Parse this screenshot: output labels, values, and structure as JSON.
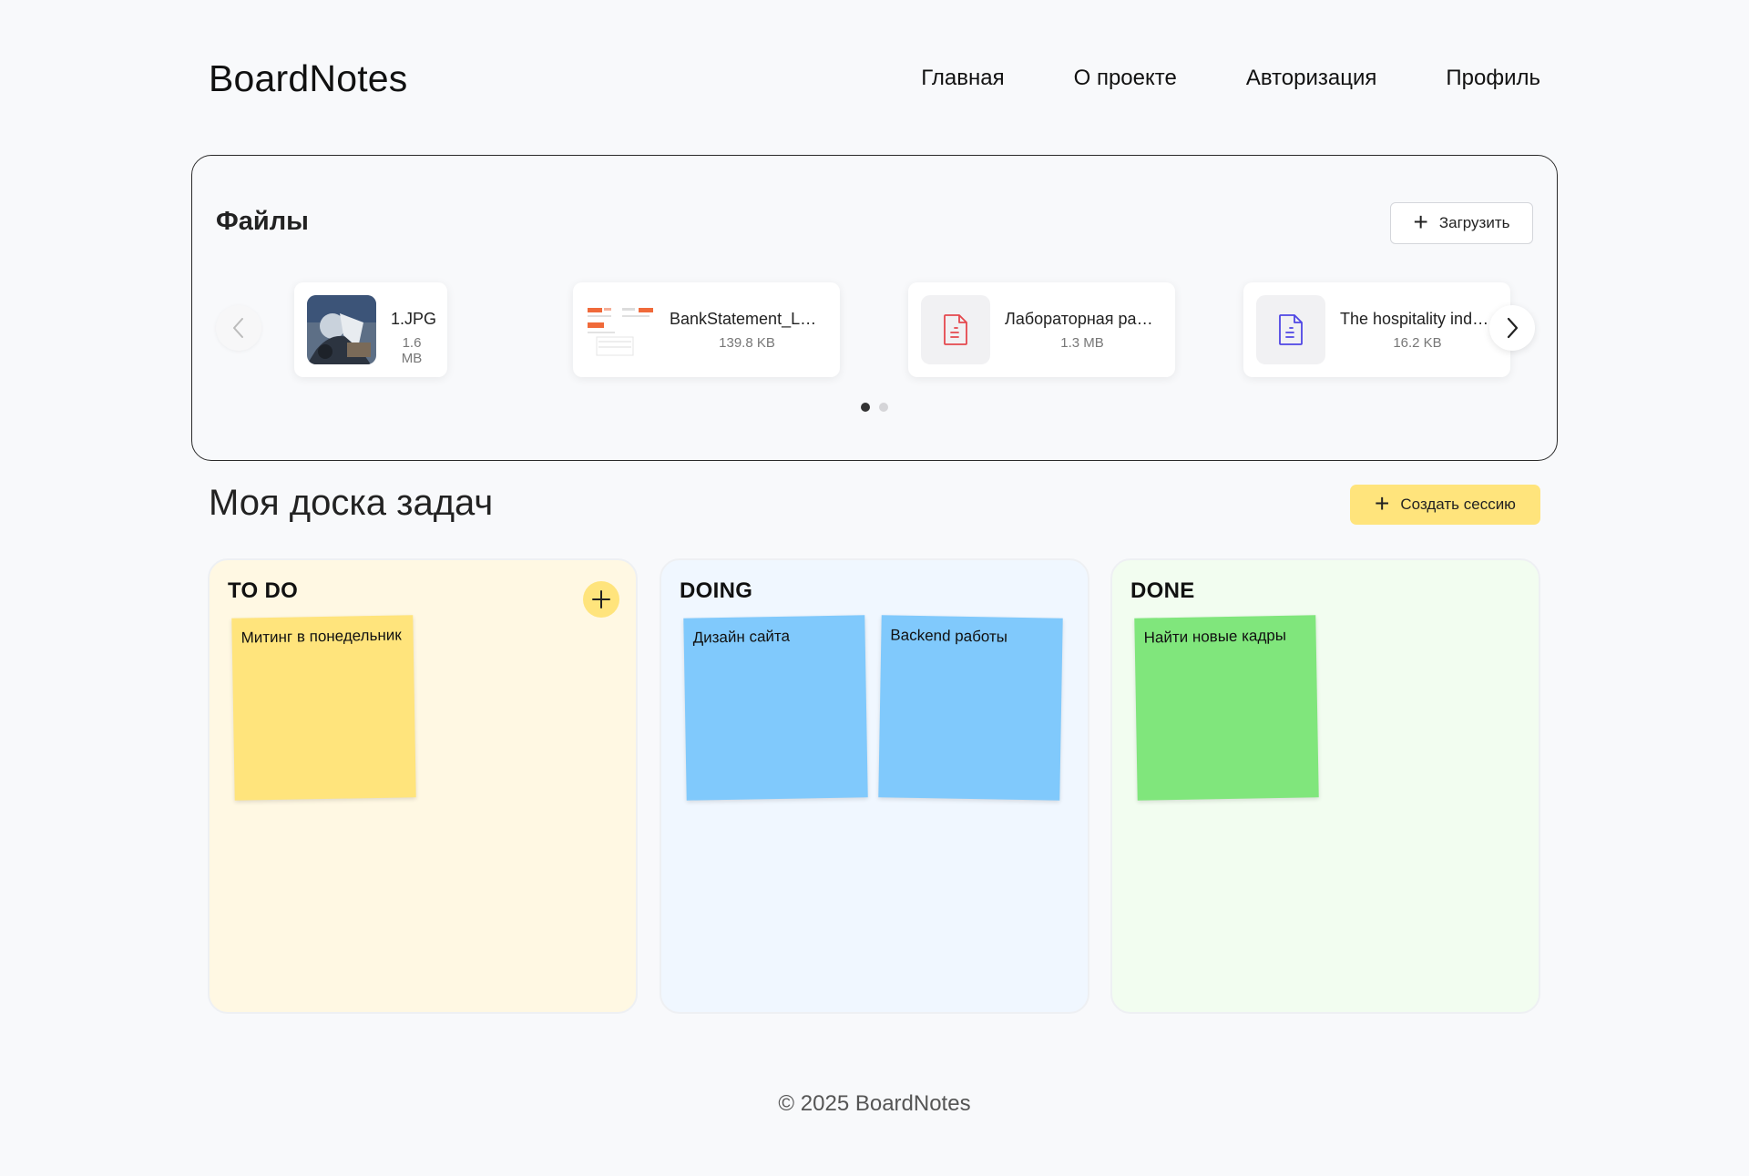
{
  "header": {
    "logo": "BoardNotes",
    "nav": [
      "Главная",
      "О проекте",
      "Авторизация",
      "Профиль"
    ]
  },
  "files": {
    "title": "Файлы",
    "upload_label": "Загрузить",
    "items": [
      {
        "name": "1.JPG",
        "size": "1.6 MB",
        "kind": "image"
      },
      {
        "name": "BankStatement_La…",
        "size": "139.8 KB",
        "kind": "statement"
      },
      {
        "name": "Лабораторная раб…",
        "size": "1.3 MB",
        "kind": "pdf"
      },
      {
        "name": "The hospitality indu…",
        "size": "16.2 KB",
        "kind": "doc"
      }
    ],
    "pagination": {
      "current": 1,
      "total": 2
    },
    "icons": {
      "prev": "chevron-left-icon",
      "next": "chevron-right-icon"
    }
  },
  "board": {
    "title": "Моя доска задач",
    "create_label": "Создать сессию",
    "columns": [
      {
        "title": "TO DO",
        "color": "#fff8e3",
        "cards": [
          {
            "text": "Митинг в понедельник",
            "color": "#ffe47c"
          }
        ]
      },
      {
        "title": "DOING",
        "color": "#f0f7ff",
        "cards": [
          {
            "text": "Дизайн сайта",
            "color": "#80c9fc"
          },
          {
            "text": "Backend работы",
            "color": "#80c9fc"
          }
        ]
      },
      {
        "title": "DONE",
        "color": "#f2fdf0",
        "cards": [
          {
            "text": "Найти новые кадры",
            "color": "#80e67c"
          }
        ]
      }
    ]
  },
  "footer": {
    "text": "© 2025 BoardNotes"
  },
  "colors": {
    "accent": "#ffe47c",
    "pdf_icon": "#e5484d",
    "doc_icon": "#4f46e5"
  }
}
